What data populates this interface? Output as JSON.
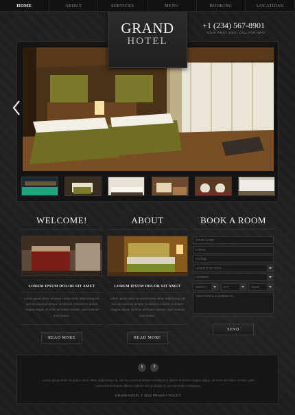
{
  "nav": {
    "items": [
      "HOME",
      "ABOUT",
      "SERVICES",
      "MENU",
      "BOOKING",
      "LOCATIONS"
    ],
    "active": "HOME"
  },
  "logo": {
    "line1": "GRAND",
    "line2": "HOTEL"
  },
  "phone": {
    "number": "+1 (234) 567-8901",
    "caption": "YOUR FIRST VISIT! CALL FOR INFO"
  },
  "welcome": {
    "heading": "WELCOME!",
    "title": "LOREM IPSUM DOLOR SIT AMET",
    "text": "Lorem ipsum dolor sit amet conse ctetur adipisicing elit, sed do eiusmod tempor incididunt ut labore et dolore magna aliqua. Ut enim ad minim veniam, quis nostrud exercitation.",
    "button": "READ MORE"
  },
  "about": {
    "heading": "ABOUT",
    "title": "LOREM IPSUM DOLOR SIT AMET",
    "text": "Lorem ipsum dolor sit amet conse ctetur adipisicing elit, sed do eiusmod tempor incididunt ut labore et dolore magna aliqua. Ut enim ad minim veniam, quis nostrud exercitation.",
    "button": "READ MORE"
  },
  "booking": {
    "heading": "BOOK A ROOM",
    "name_placeholder": "YOUR NAME",
    "email_placeholder": "E-MAIL",
    "phone_placeholder": "PHONE",
    "length_placeholder": "LENGTH OF STAY",
    "number_placeholder": "NUMBER",
    "month_placeholder": "MONTH",
    "day_placeholder": "DAY",
    "year_placeholder": "YEAR",
    "comments_placeholder": "ADDITIONAL COMMENTS",
    "button": "SEND"
  },
  "footer": {
    "social": [
      "t",
      "f"
    ],
    "text": "Lorem ipsum dolor sit amet conse ctetur adipisicing elit, sed do eiusmod tempor incididunt ut labore et dolore magna aliqua. Ut enim ad minim veniam, quis nostrud exercitation ullamco laboris nisi ut aliquip ex ea commodo consequat.",
    "copyright": "GRAND HOTEL © 2012 PRIVACY POLICY"
  }
}
